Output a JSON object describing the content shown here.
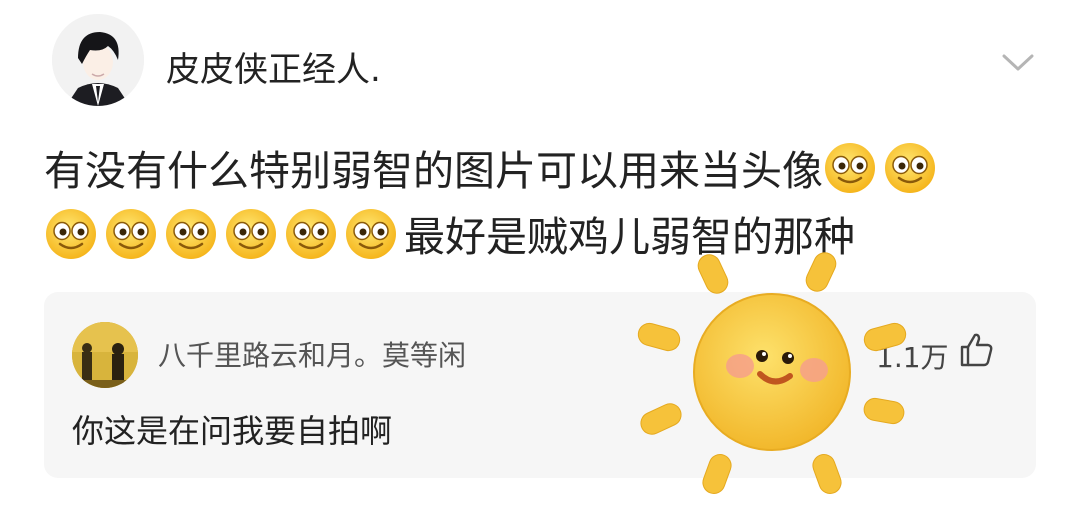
{
  "post": {
    "author": "皮皮侠正经人.",
    "text_line1": "有没有什么特别弱智的图片可以用来当头像",
    "text_line2": "最好是贼鸡儿弱智的那种",
    "emoji_icon": "smiling-face-emoji"
  },
  "comment": {
    "author": "八千里路云和月。莫等闲",
    "text": "你这是在问我要自拍啊",
    "likes": "1.1万"
  },
  "sticker": {
    "icon": "cute-sun-sticker"
  },
  "colors": {
    "card_bg": "#f6f6f6",
    "emoji_yellow": "#ffd23a",
    "sun_yellow": "#f8c93d"
  }
}
